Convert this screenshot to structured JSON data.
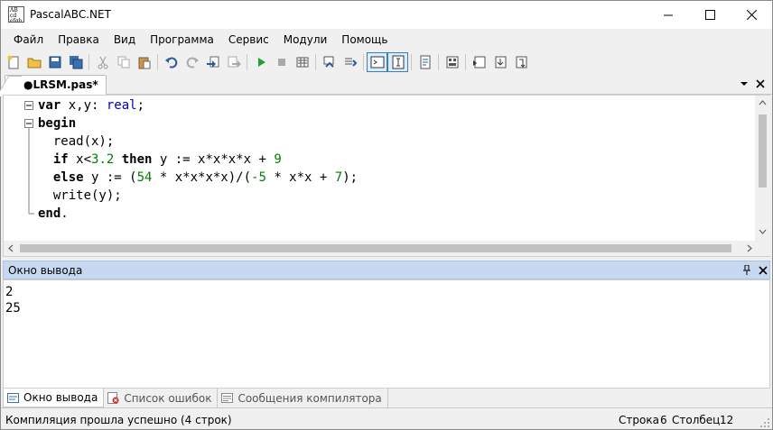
{
  "window": {
    "title": "PascalABC.NET",
    "icon": "pascalabc-app-icon",
    "icon_text": "AB\ncd\nefgh"
  },
  "menu": [
    "Файл",
    "Правка",
    "Вид",
    "Программа",
    "Сервис",
    "Модули",
    "Помощь"
  ],
  "toolbar_icons": [
    "new-file-icon",
    "open-file-icon",
    "save-icon",
    "save-all-icon",
    "cut-icon",
    "copy-icon",
    "paste-icon",
    "undo-icon",
    "redo-icon",
    "navigate-back-icon",
    "navigate-forward-icon",
    "run-icon",
    "stop-icon",
    "compile-icon",
    "debug-step-icon",
    "debug-step-over-icon",
    "output-window-icon",
    "error-list-icon",
    "properties-icon",
    "form-designer-icon",
    "debug-icon",
    "step-into-icon",
    "step-out-icon"
  ],
  "tab": {
    "label": "●LRSM.pas*"
  },
  "editor": {
    "lines": [
      [
        {
          "t": "var",
          "k": "kw"
        },
        {
          "t": " x,y: ",
          "k": "plain"
        },
        {
          "t": "real",
          "k": "ty"
        },
        {
          "t": ";",
          "k": "plain"
        }
      ],
      [
        {
          "t": "begin",
          "k": "kw"
        }
      ],
      [
        {
          "t": "  read(x);",
          "k": "plain"
        }
      ],
      [
        {
          "t": "  ",
          "k": "plain"
        },
        {
          "t": "if",
          "k": "kw"
        },
        {
          "t": " x<",
          "k": "plain"
        },
        {
          "t": "3.2",
          "k": "num"
        },
        {
          "t": " ",
          "k": "plain"
        },
        {
          "t": "then",
          "k": "kw"
        },
        {
          "t": " y := x*x*x*x + ",
          "k": "plain"
        },
        {
          "t": "9",
          "k": "num"
        }
      ],
      [
        {
          "t": "  ",
          "k": "plain"
        },
        {
          "t": "else",
          "k": "kw"
        },
        {
          "t": " y := (",
          "k": "plain"
        },
        {
          "t": "54",
          "k": "num"
        },
        {
          "t": " * x*x*x*x)/(",
          "k": "plain"
        },
        {
          "t": "-5",
          "k": "num"
        },
        {
          "t": " * x*x + ",
          "k": "plain"
        },
        {
          "t": "7",
          "k": "num"
        },
        {
          "t": ");",
          "k": "plain"
        }
      ],
      [
        {
          "t": "  write(y);",
          "k": "plain"
        }
      ],
      [
        {
          "t": "end",
          "k": "kw"
        },
        {
          "t": ".",
          "k": "plain"
        }
      ]
    ]
  },
  "output": {
    "title": "Окно вывода",
    "lines": [
      "2",
      "25"
    ]
  },
  "bottom_tabs": [
    {
      "label": "Окно вывода",
      "icon": "output-window-icon",
      "active": true
    },
    {
      "label": "Список ошибок",
      "icon": "error-list-icon",
      "active": false
    },
    {
      "label": "Сообщения компилятора",
      "icon": "compiler-messages-icon",
      "active": false
    }
  ],
  "status": {
    "message": "Компиляция прошла успешно (4 строк)",
    "row_label": "Строка",
    "row": "6",
    "col_label": "Столбец",
    "col": "12"
  }
}
